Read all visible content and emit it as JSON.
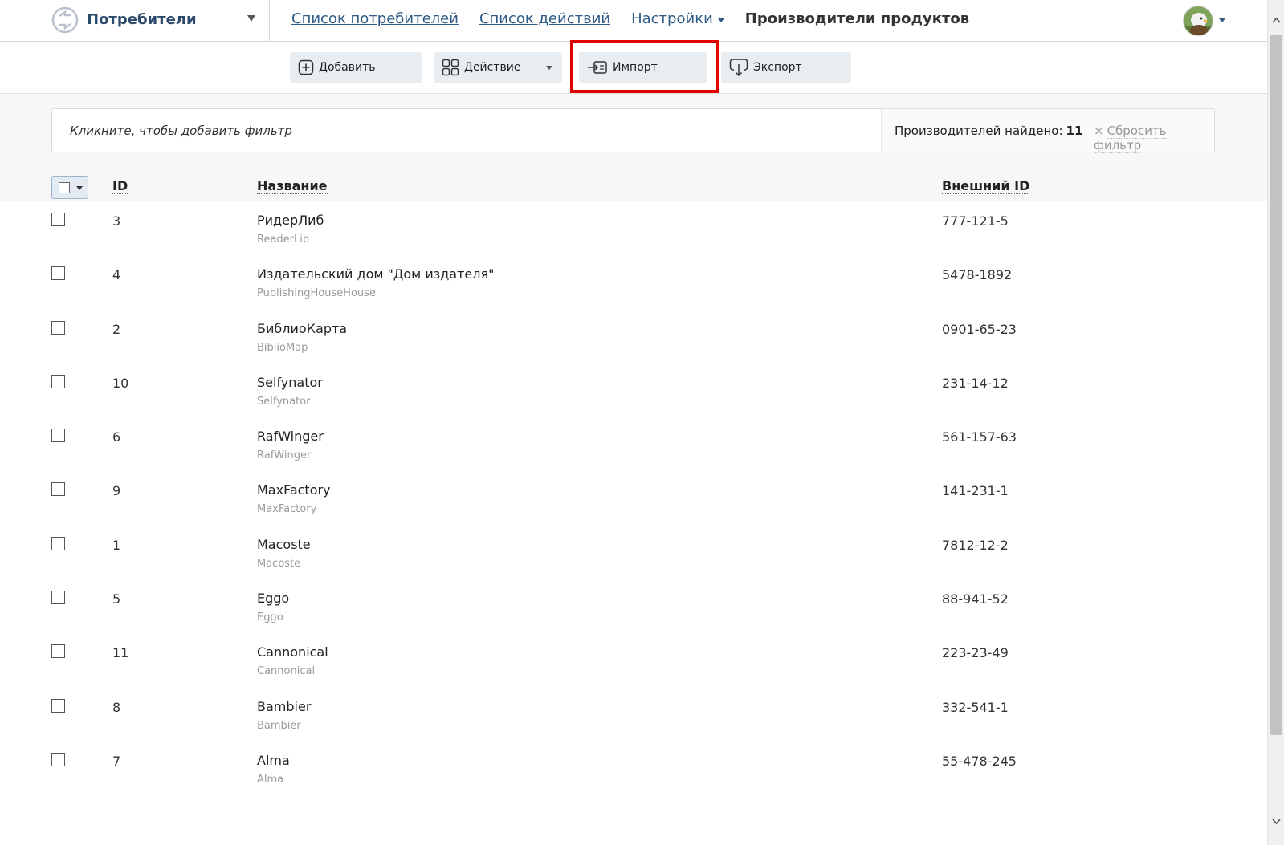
{
  "header": {
    "app_title": "Потребители",
    "nav": {
      "consumers_list": "Список потребителей",
      "actions_list": "Список действий",
      "settings": "Настройки",
      "current": "Производители продуктов"
    }
  },
  "toolbar": {
    "add_label": "Добавить",
    "action_label": "Действие",
    "import_label": "Импорт",
    "export_label": "Экспорт"
  },
  "filter": {
    "placeholder": "Кликните, чтобы добавить фильтр",
    "found_label": "Производителей найдено:",
    "found_count": "11",
    "reset_label": "Сбросить фильтр",
    "reset_icon": "×"
  },
  "table": {
    "columns": {
      "id": "ID",
      "name": "Название",
      "external_id": "Внешний ID"
    },
    "rows": [
      {
        "id": "3",
        "name": "РидерЛиб",
        "alias": "ReaderLib",
        "ext": "777-121-5"
      },
      {
        "id": "4",
        "name": "Издательский дом \"Дом издателя\"",
        "alias": "PublishingHouseHouse",
        "ext": "5478-1892"
      },
      {
        "id": "2",
        "name": "БиблиоКарта",
        "alias": "BiblioMap",
        "ext": "0901-65-23"
      },
      {
        "id": "10",
        "name": "Selfynator",
        "alias": "Selfynator",
        "ext": "231-14-12"
      },
      {
        "id": "6",
        "name": "RafWinger",
        "alias": "RafWinger",
        "ext": "561-157-63"
      },
      {
        "id": "9",
        "name": "MaxFactory",
        "alias": "MaxFactory",
        "ext": "141-231-1"
      },
      {
        "id": "1",
        "name": "Macoste",
        "alias": "Macoste",
        "ext": "7812-12-2"
      },
      {
        "id": "5",
        "name": "Eggo",
        "alias": "Eggo",
        "ext": "88-941-52"
      },
      {
        "id": "11",
        "name": "Cannonical",
        "alias": "Cannonical",
        "ext": "223-23-49"
      },
      {
        "id": "8",
        "name": "Bambier",
        "alias": "Bambier",
        "ext": "332-541-1"
      },
      {
        "id": "7",
        "name": "Alma",
        "alias": "Alma",
        "ext": "55-478-245"
      }
    ]
  },
  "colors": {
    "link": "#2f5b86",
    "button_bg": "#e8edf2",
    "highlight": "#e00000"
  },
  "icons": {
    "logo": "refresh-arrows-icon",
    "add": "plus-square-icon",
    "action": "grid-icon",
    "import": "import-icon",
    "export": "export-download-icon"
  }
}
